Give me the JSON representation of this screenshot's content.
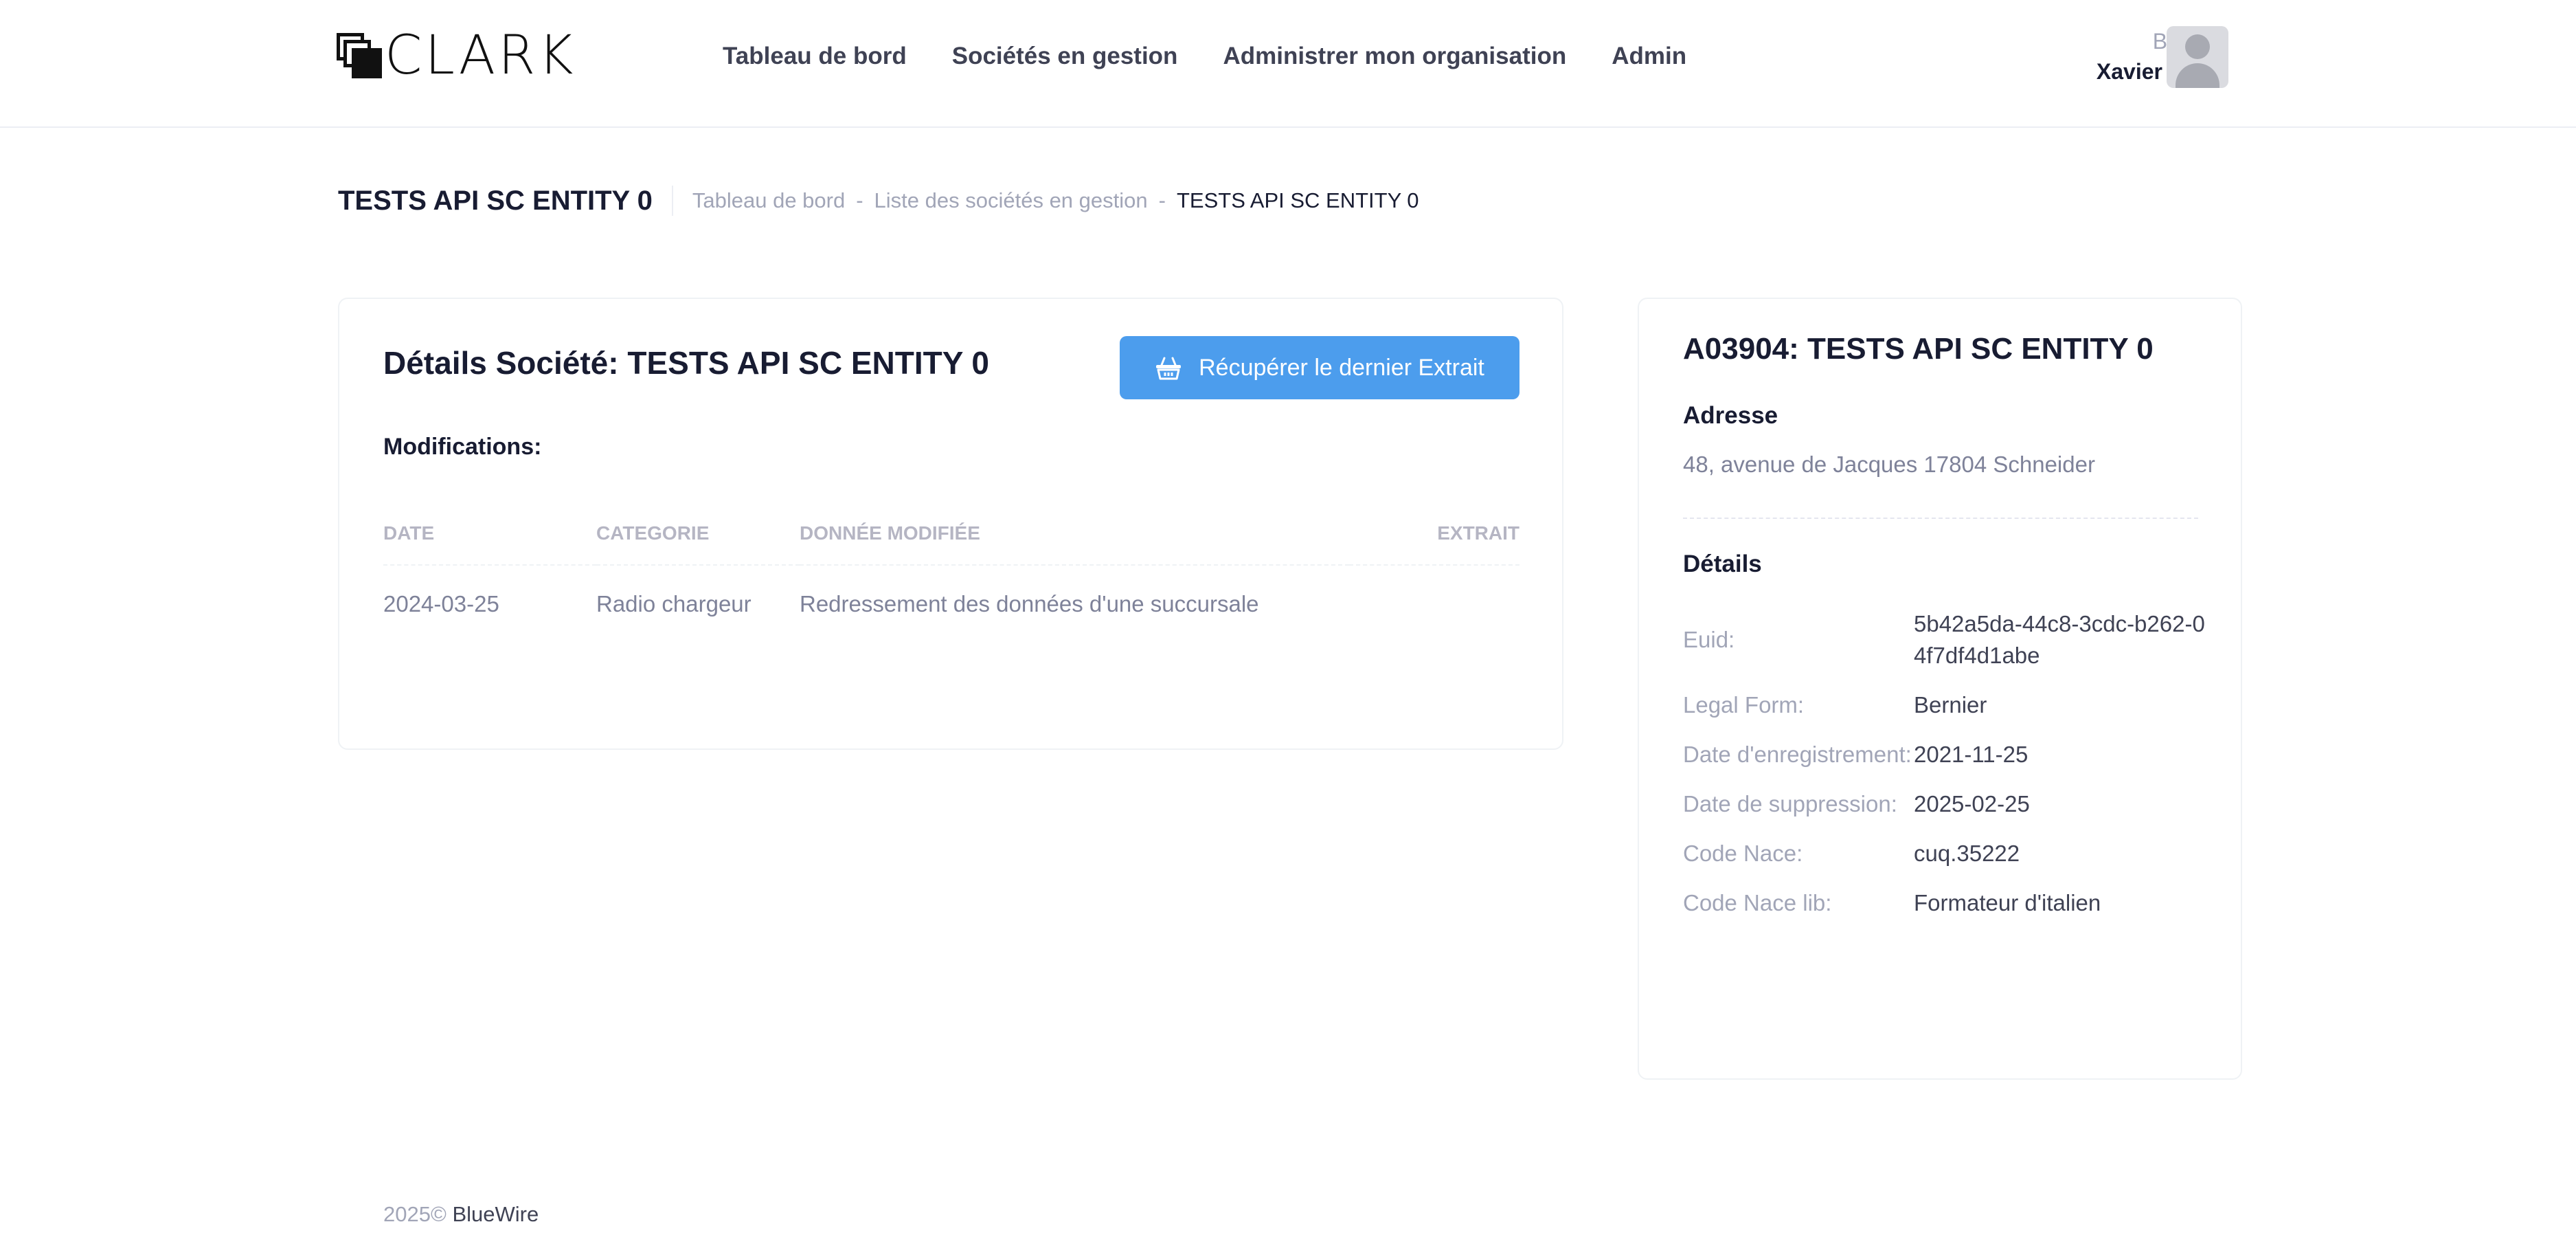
{
  "header": {
    "logo_text": "CLARK",
    "nav": [
      {
        "label": "Tableau de bord"
      },
      {
        "label": "Sociétés en gestion"
      },
      {
        "label": "Administrer mon organisation"
      },
      {
        "label": "Admin"
      }
    ],
    "user": {
      "greeting": "Bonjour",
      "name": "Xavier Lauer"
    }
  },
  "toolbar": {
    "title": "TESTS API SC ENTITY 0",
    "breadcrumb": [
      "Tableau de bord",
      "Liste des sociétés en gestion",
      "TESTS API SC ENTITY 0"
    ],
    "dash": "-"
  },
  "details": {
    "title": "Détails Société: TESTS API SC ENTITY 0",
    "button_label": "Récupérer le dernier Extrait",
    "modifications_label": "Modifications:",
    "columns": [
      "DATE",
      "CATEGORIE",
      "DONNÉE MODIFIÉE",
      "EXTRAIT"
    ],
    "rows": [
      {
        "date": "2024-03-25",
        "category": "Radio chargeur",
        "data": "Redressement des données d'une succursale",
        "extract": ""
      }
    ]
  },
  "entity": {
    "title": "A03904: TESTS API SC ENTITY 0",
    "address_label": "Adresse",
    "address": "48, avenue de Jacques 17804 Schneider",
    "details_label": "Détails",
    "fields": [
      {
        "key": "Euid:",
        "value": "5b42a5da-44c8-3cdc-b262-04f7df4d1abe"
      },
      {
        "key": "Legal Form:",
        "value": "Bernier"
      },
      {
        "key": "Date d'enregistrement:",
        "value": "2021-11-25"
      },
      {
        "key": "Date de suppression:",
        "value": "2025-02-25"
      },
      {
        "key": "Code Nace:",
        "value": "cuq.35222"
      },
      {
        "key": "Code Nace lib:",
        "value": "Formateur d'italien"
      }
    ]
  },
  "footer": {
    "year": "2025©",
    "brand": "BlueWire"
  },
  "colors": {
    "accent": "#4c9ded",
    "text_dark": "#181c32",
    "text_muted": "#a1a5b7"
  },
  "icons": {
    "button": "basket-icon",
    "avatar": "user-avatar-icon"
  }
}
